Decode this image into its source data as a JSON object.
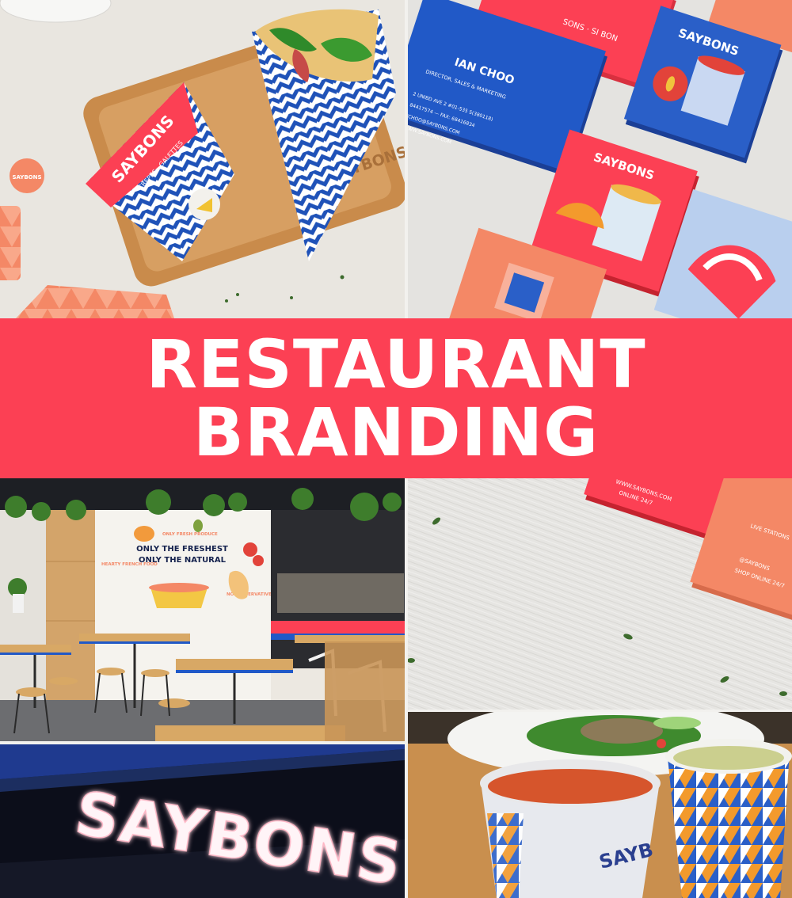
{
  "banner": {
    "line1": "RESTAURANT",
    "line2": "BRANDING"
  },
  "photos": {
    "crepes": {
      "wrapper_brand": "SAYBONS",
      "wrapper_tagline": "CREPES · GALETTES",
      "tray_engraving": "SAYBONS",
      "sticker_brand": "SAYBONS"
    },
    "cards": {
      "top_card_text": "SONS · SI BON",
      "person_name": "IAN CHOO",
      "person_title": "DIRECTOR, SALES & MARKETING",
      "address_line": "2 UNIBD AVE 2 #01-535 S(380118)",
      "phone_line": "84417574 — FAX: 68416834",
      "email_line": "ICHOO@SAYBONS.COM",
      "web_line": "WWW.SAYBONS.COM",
      "card_brand_a": "SAYBONS",
      "card_brand_b": "SAYBONS"
    },
    "interior": {
      "mural_headline_1": "ONLY THE FRESHEST",
      "mural_headline_2": "ONLY THE NATURAL",
      "mural_left": "HEARTY FRENCH FOOD",
      "mural_center": "ONLY FRESH PRODUCE",
      "mural_right": "NO PRESERVATIVES"
    },
    "cards_back": {
      "line_a": "WWW.SAYBONS.COM",
      "line_b": "ONLINE 24/7",
      "line_c": "LIVE STATIONS",
      "line_d": "@SAYBONS",
      "line_e": "SHOP ONLINE 24/7"
    },
    "signage": {
      "sign_text": "SAYBONS"
    },
    "soup": {
      "cup_brand": "SAYB"
    }
  },
  "colors": {
    "brand_red": "#fc4054",
    "brand_blue": "#1f52b8",
    "brand_orange": "#f48866",
    "navy": "#14214d"
  }
}
